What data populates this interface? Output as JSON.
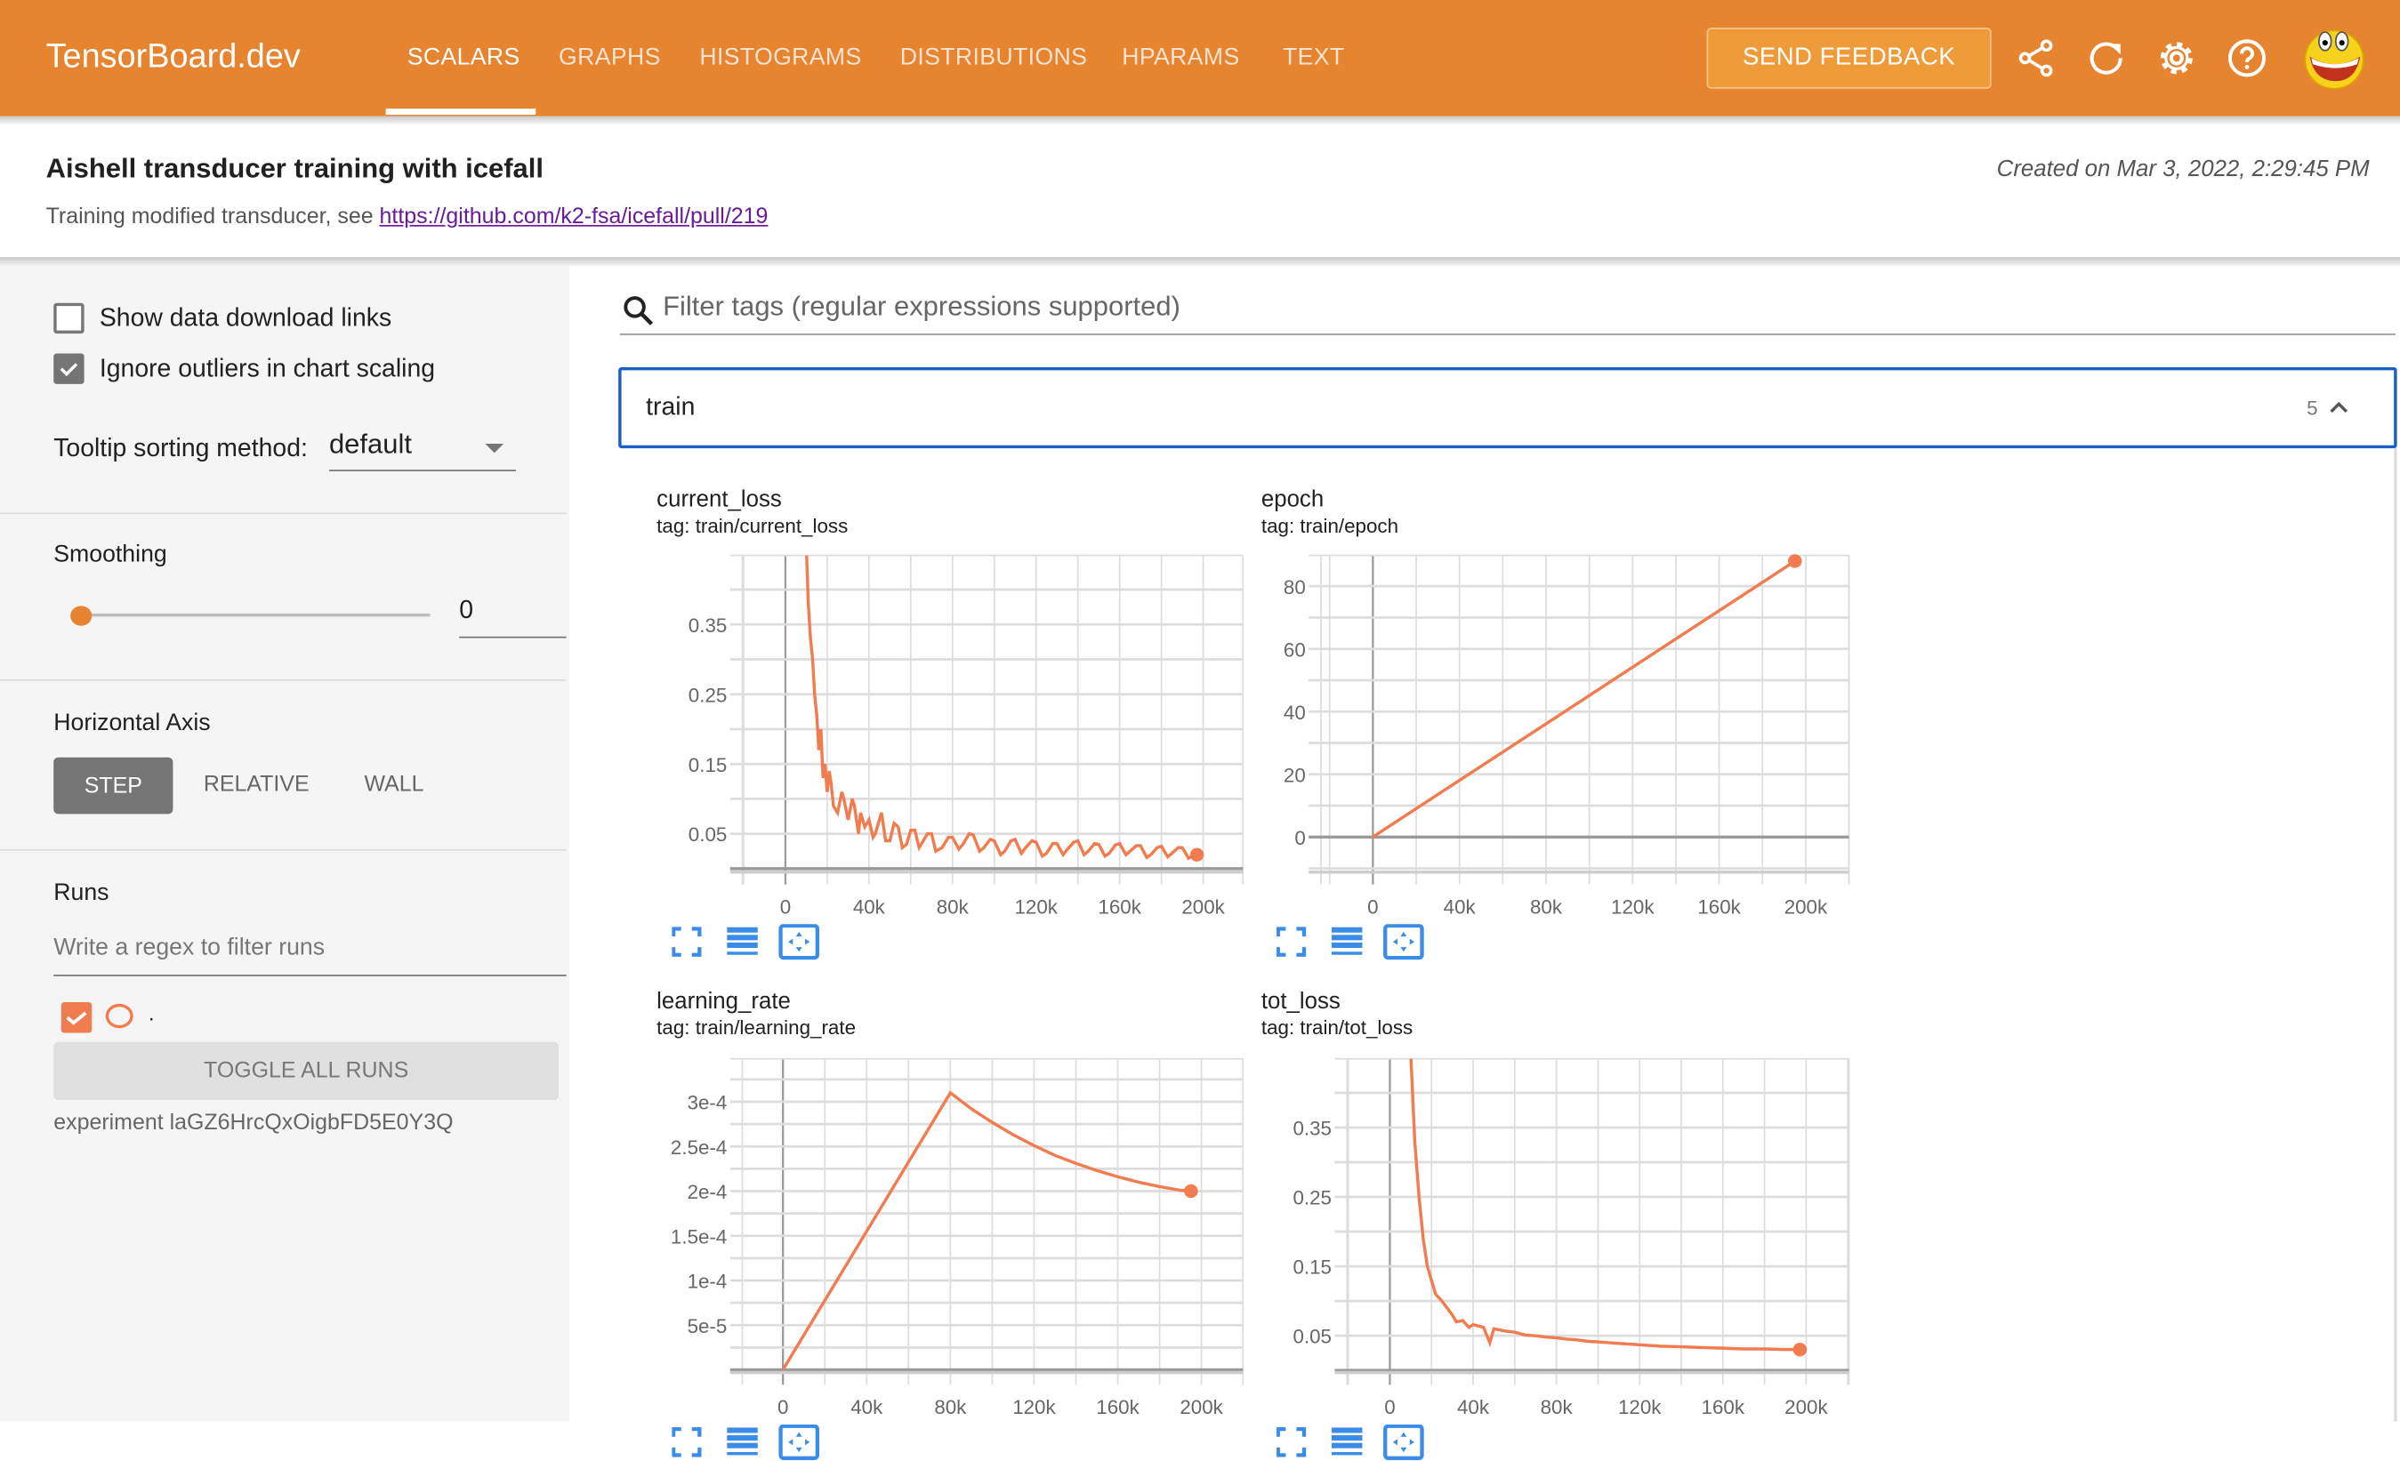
{
  "header": {
    "logo": "TensorBoard.dev",
    "tabs": [
      {
        "label": "SCALARS",
        "active": true
      },
      {
        "label": "GRAPHS"
      },
      {
        "label": "HISTOGRAMS"
      },
      {
        "label": "DISTRIBUTIONS"
      },
      {
        "label": "HPARAMS"
      },
      {
        "label": "TEXT"
      }
    ],
    "feedback": "SEND FEEDBACK",
    "icons": [
      "share-icon",
      "refresh-icon",
      "settings-icon",
      "help-icon",
      "avatar-icon"
    ],
    "color": "#e6842f"
  },
  "experiment": {
    "title": "Aishell transducer training with icefall",
    "description": "Training modified transducer, see ",
    "link": "https://github.com/k2-fsa/icefall/pull/219",
    "created": "Created on Mar 3, 2022, 2:29:45 PM"
  },
  "sidebar": {
    "show_download": {
      "label": "Show data download links",
      "checked": false
    },
    "ignore_outliers": {
      "label": "Ignore outliers in chart scaling",
      "checked": true
    },
    "tooltip_label": "Tooltip sorting method:",
    "tooltip_value": "default",
    "smoothing_label": "Smoothing",
    "smoothing_value": "0",
    "haxis_label": "Horizontal Axis",
    "haxis_options": [
      "STEP",
      "RELATIVE",
      "WALL"
    ],
    "haxis_selected": "STEP",
    "runs_label": "Runs",
    "runs_placeholder": "Write a regex to filter runs",
    "run_name": ".",
    "run_color": "#f07c4f",
    "toggle_all": "TOGGLE ALL RUNS",
    "experiment_id": "experiment laGZ6HrcQxOigbFD5E0Y3Q"
  },
  "main": {
    "filter_placeholder": "Filter tags (regular expressions supported)",
    "group": {
      "name": "train",
      "count": "5"
    }
  },
  "chart_data": [
    {
      "type": "line",
      "title": "current_loss",
      "subtitle": "tag: train/current_loss",
      "xlim": [
        -20600,
        219000
      ],
      "ylim": [
        -0.005,
        0.449
      ],
      "xticks": [
        0,
        40000,
        80000,
        120000,
        160000,
        200000
      ],
      "xtick_labels": [
        "0",
        "40k",
        "80k",
        "120k",
        "160k",
        "200k"
      ],
      "yticks": [
        0.05,
        0.15,
        0.25,
        0.35
      ],
      "ytick_labels": [
        "0.05",
        "0.15",
        "0.25",
        "0.35"
      ],
      "grid": true,
      "color": "#f07c4f",
      "x": [
        10000,
        11000,
        12000,
        13000,
        14000,
        15000,
        16000,
        17000,
        18000,
        19000,
        20000,
        21000,
        22000,
        23000,
        25000,
        27000,
        28000,
        30000,
        32000,
        33000,
        35000,
        36000,
        38000,
        40000,
        42000,
        43000,
        46000,
        48000,
        50000,
        52000,
        54000,
        56000,
        58000,
        60000,
        62000,
        64000,
        66000,
        68000,
        70000,
        72000,
        75000,
        78000,
        80000,
        83000,
        85000,
        88000,
        90000,
        93000,
        95000,
        98000,
        100000,
        103000,
        105000,
        108000,
        110000,
        113000,
        115000,
        118000,
        120000,
        123000,
        125000,
        128000,
        130000,
        133000,
        135000,
        138000,
        140000,
        143000,
        145000,
        148000,
        150000,
        153000,
        155000,
        158000,
        160000,
        163000,
        165000,
        168000,
        170000,
        173000,
        175000,
        178000,
        180000,
        183000,
        185000,
        188000,
        190000,
        193000,
        195000,
        197000
      ],
      "y": [
        0.46,
        0.38,
        0.33,
        0.3,
        0.25,
        0.22,
        0.17,
        0.2,
        0.13,
        0.15,
        0.11,
        0.14,
        0.12,
        0.09,
        0.08,
        0.11,
        0.1,
        0.07,
        0.1,
        0.09,
        0.05,
        0.08,
        0.06,
        0.07,
        0.045,
        0.05,
        0.08,
        0.04,
        0.04,
        0.065,
        0.06,
        0.03,
        0.035,
        0.055,
        0.055,
        0.03,
        0.04,
        0.05,
        0.05,
        0.025,
        0.03,
        0.045,
        0.045,
        0.028,
        0.035,
        0.05,
        0.048,
        0.025,
        0.03,
        0.042,
        0.04,
        0.02,
        0.025,
        0.04,
        0.042,
        0.022,
        0.03,
        0.04,
        0.038,
        0.018,
        0.022,
        0.036,
        0.036,
        0.02,
        0.028,
        0.038,
        0.04,
        0.02,
        0.025,
        0.036,
        0.035,
        0.018,
        0.022,
        0.034,
        0.036,
        0.02,
        0.025,
        0.033,
        0.033,
        0.016,
        0.02,
        0.03,
        0.032,
        0.017,
        0.022,
        0.03,
        0.03,
        0.015,
        0.018,
        0.02
      ]
    },
    {
      "type": "line",
      "title": "epoch",
      "subtitle": "tag: train/epoch",
      "xlim": [
        -24000,
        220000
      ],
      "ylim": [
        -11.2,
        89.8
      ],
      "xticks": [
        0,
        40000,
        80000,
        120000,
        160000,
        200000
      ],
      "xtick_labels": [
        "0",
        "40k",
        "80k",
        "120k",
        "160k",
        "200k"
      ],
      "yticks": [
        0,
        20,
        40,
        60,
        80
      ],
      "ytick_labels": [
        "0",
        "20",
        "40",
        "60",
        "80"
      ],
      "grid": true,
      "color": "#f07c4f",
      "x": [
        0,
        195000
      ],
      "y": [
        0,
        88
      ]
    },
    {
      "type": "line",
      "title": "learning_rate",
      "subtitle": "tag: train/learning_rate",
      "xlim": [
        -19400,
        219800
      ],
      "ylim": [
        -3e-06,
        0.000348
      ],
      "xticks": [
        0,
        40000,
        80000,
        120000,
        160000,
        200000
      ],
      "xtick_labels": [
        "0",
        "40k",
        "80k",
        "120k",
        "160k",
        "200k"
      ],
      "yticks": [
        5e-05,
        0.0001,
        0.00015,
        0.0002,
        0.00025,
        0.0003
      ],
      "ytick_labels": [
        "5e-5",
        "1e-4",
        "1.5e-4",
        "2e-4",
        "2.5e-4",
        "3e-4"
      ],
      "grid": true,
      "color": "#f07c4f",
      "x": [
        0,
        80000,
        90000,
        100000,
        110000,
        120000,
        130000,
        140000,
        150000,
        160000,
        170000,
        180000,
        190000,
        195000
      ],
      "y": [
        0,
        0.00031,
        0.000292,
        0.000277,
        0.000263,
        0.000251,
        0.00024,
        0.000231,
        0.000223,
        0.000216,
        0.00021,
        0.000205,
        0.000201,
        0.0002
      ]
    },
    {
      "type": "line",
      "title": "tot_loss",
      "subtitle": "tag: train/tot_loss",
      "xlim": [
        -20600,
        220600
      ],
      "ylim": [
        -0.003,
        0.449
      ],
      "xticks": [
        0,
        40000,
        80000,
        120000,
        160000,
        200000
      ],
      "xtick_labels": [
        "0",
        "40k",
        "80k",
        "120k",
        "160k",
        "200k"
      ],
      "yticks": [
        0.05,
        0.15,
        0.25,
        0.35
      ],
      "ytick_labels": [
        "0.05",
        "0.15",
        "0.25",
        "0.35"
      ],
      "grid": true,
      "color": "#f07c4f",
      "x": [
        10000,
        12000,
        14000,
        16000,
        18000,
        20000,
        22000,
        25000,
        28000,
        30000,
        32000,
        35000,
        38000,
        40000,
        45000,
        48000,
        50000,
        55000,
        60000,
        65000,
        70000,
        75000,
        80000,
        85000,
        90000,
        95000,
        100000,
        105000,
        110000,
        120000,
        130000,
        140000,
        150000,
        160000,
        170000,
        180000,
        190000,
        197000
      ],
      "y": [
        0.46,
        0.33,
        0.25,
        0.19,
        0.15,
        0.13,
        0.11,
        0.1,
        0.088,
        0.08,
        0.07,
        0.072,
        0.062,
        0.066,
        0.062,
        0.04,
        0.06,
        0.057,
        0.055,
        0.051,
        0.05,
        0.048,
        0.047,
        0.045,
        0.044,
        0.042,
        0.041,
        0.04,
        0.039,
        0.037,
        0.035,
        0.034,
        0.033,
        0.032,
        0.031,
        0.031,
        0.03,
        0.03
      ]
    }
  ]
}
